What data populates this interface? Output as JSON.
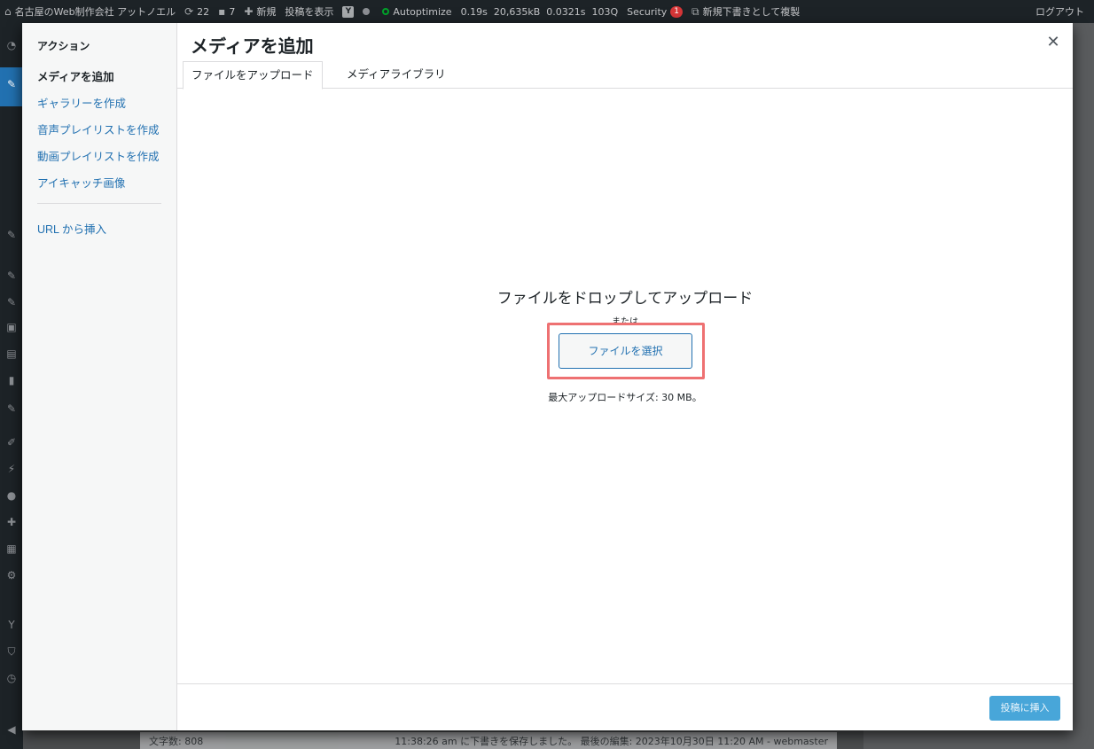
{
  "adminbar": {
    "site_name": "名古屋のWeb制作会社 アットノエル",
    "updates_count": "22",
    "comments_count": "7",
    "new_label": "新規",
    "view_post": "投稿を表示",
    "autoptimize": "Autoptimize",
    "stat_time": "0.19s",
    "stat_memory": "20,635kB",
    "stat_query_time": "0.0321s",
    "stat_queries": "103Q",
    "security": "Security",
    "security_badge": "1",
    "duplicate_draft": "新規下書きとして複製",
    "logout": "ログアウト"
  },
  "modal": {
    "title": "メディアを追加",
    "close_icon": "close-icon",
    "menu": {
      "heading": "アクション",
      "items": [
        {
          "label": "メディアを追加",
          "active": true
        },
        {
          "label": "ギャラリーを作成",
          "active": false
        },
        {
          "label": "音声プレイリストを作成",
          "active": false
        },
        {
          "label": "動画プレイリストを作成",
          "active": false
        },
        {
          "label": "アイキャッチ画像",
          "active": false
        }
      ],
      "insert_from_url": "URL から挿入"
    },
    "tabs": [
      {
        "label": "ファイルをアップロード",
        "active": true
      },
      {
        "label": "メディアライブラリ",
        "active": false
      }
    ],
    "uploader": {
      "drop_title": "ファイルをドロップしてアップロード",
      "or_text": "または",
      "select_button": "ファイルを選択",
      "max_size": "最大アップロードサイズ: 30 MB。"
    },
    "insert_button": "投稿に挿入"
  },
  "background": {
    "word_count": "文字数: 808",
    "autosave": "11:38:26 am に下書きを保存しました。 最後の編集: 2023年10月30日 11:20 AM - webmaster"
  },
  "colors": {
    "accent": "#2271b1",
    "highlight": "#ee7172",
    "insert_button": "#2997d3"
  }
}
